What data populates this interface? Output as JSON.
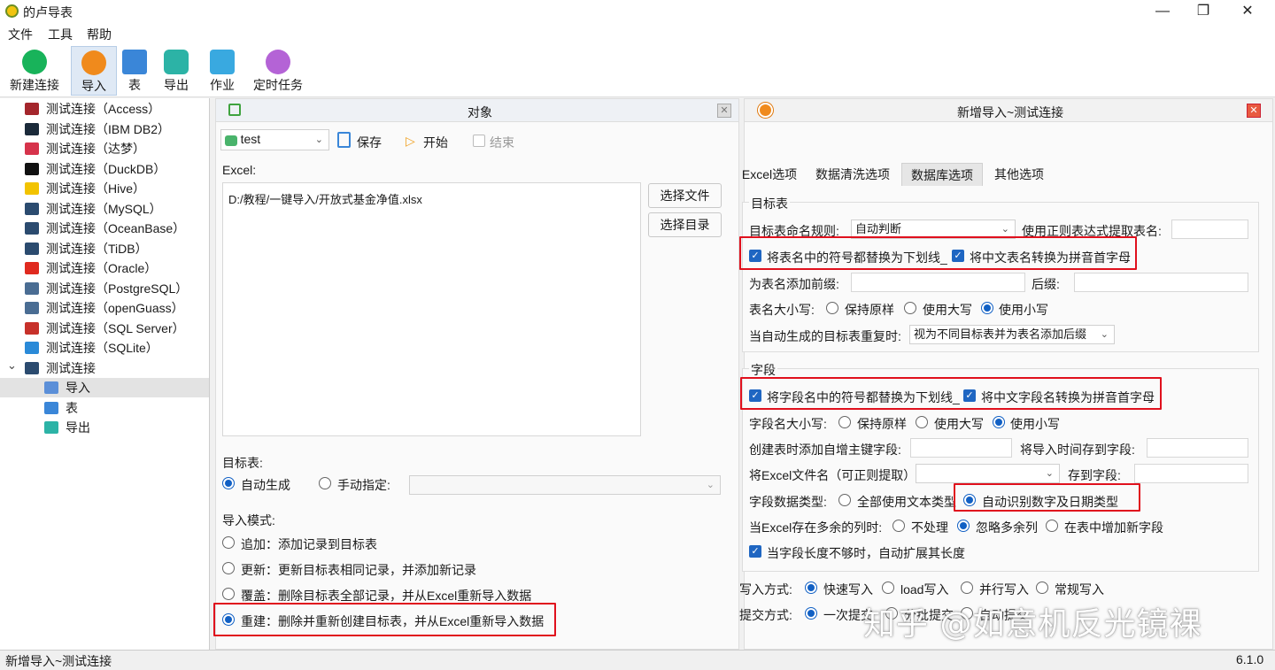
{
  "window": {
    "title": "的卢导表",
    "min_glyph": "—",
    "max_glyph": "❐",
    "close_glyph": "✕"
  },
  "menu": [
    "文件",
    "工具",
    "帮助"
  ],
  "toolbar": [
    {
      "label": "新建连接",
      "icon": "link-icon",
      "color": "#18b35a"
    },
    {
      "label": "导入",
      "icon": "import-icon",
      "color": "#f08a1c"
    },
    {
      "label": "表",
      "icon": "table-icon",
      "color": "#3a86d8"
    },
    {
      "label": "导出",
      "icon": "export-icon",
      "color": "#2cb3a6"
    },
    {
      "label": "作业",
      "icon": "job-icon",
      "color": "#39a9e0"
    },
    {
      "label": "定时任务",
      "icon": "schedule-icon",
      "color": "#b463d6"
    }
  ],
  "tree": {
    "connections": [
      {
        "label": "测试连接（Access）",
        "color": "#a4262c"
      },
      {
        "label": "测试连接（IBM DB2）",
        "color": "#1b2a3a"
      },
      {
        "label": "测试连接（达梦）",
        "color": "#d6334b"
      },
      {
        "label": "测试连接（DuckDB）",
        "color": "#111111"
      },
      {
        "label": "测试连接（Hive）",
        "color": "#f2c300"
      },
      {
        "label": "测试连接（MySQL）",
        "color": "#2b4b6f"
      },
      {
        "label": "测试连接（OceanBase）",
        "color": "#2b4b6f"
      },
      {
        "label": "测试连接（TiDB）",
        "color": "#2b4b6f"
      },
      {
        "label": "测试连接（Oracle）",
        "color": "#e02a1f"
      },
      {
        "label": "测试连接（PostgreSQL）",
        "color": "#4a6d93"
      },
      {
        "label": "测试连接（openGuass）",
        "color": "#4a6d93"
      },
      {
        "label": "测试连接（SQL Server）",
        "color": "#c7312a"
      },
      {
        "label": "测试连接（SQLite）",
        "color": "#2a8ad8"
      },
      {
        "label": "测试连接",
        "color": "#2b4b6f"
      }
    ],
    "children": [
      {
        "label": "导入",
        "color": "#5b8fd8"
      },
      {
        "label": "表",
        "color": "#3a86d8"
      },
      {
        "label": "导出",
        "color": "#2cb3a6"
      }
    ],
    "expander": "⌄"
  },
  "object_panel": {
    "title": "对象",
    "db_select": "test",
    "save": "保存",
    "start": "开始",
    "end": "结束",
    "excel_label": "Excel:",
    "excel_path": "D:/教程/一键导入/开放式基金净值.xlsx",
    "choose_file": "选择文件",
    "choose_dir": "选择目录",
    "target_label": "目标表:",
    "auto_gen": "自动生成",
    "manual": "手动指定:",
    "mode_label": "导入模式:",
    "modes": [
      "追加：添加记录到目标表",
      "更新：更新目标表相同记录，并添加新记录",
      "覆盖：删除目标表全部记录，并从Excel重新导入数据",
      "重建：删除并重新创建目标表，并从Excel重新导入数据"
    ]
  },
  "import_panel": {
    "title": "新增导入~测试连接",
    "tabs": [
      "Excel选项",
      "数据清洗选项",
      "数据库选项",
      "其他选项"
    ],
    "target_group": "目标表",
    "naming_rule_label": "目标表命名规则:",
    "naming_rule_value": "自动判断",
    "regex_label": "使用正则表达式提取表名:",
    "cb_table_symbols": "将表名中的符号都替换为下划线_",
    "cb_table_pinyin": "将中文表名转换为拼音首字母",
    "prefix_label": "为表名添加前缀:",
    "suffix_label": "后缀:",
    "case_label": "表名大小写:",
    "keep": "保持原样",
    "upper": "使用大写",
    "lower": "使用小写",
    "dup_label": "当自动生成的目标表重复时:",
    "dup_value": "视为不同目标表并为表名添加后缀",
    "field_group": "字段",
    "cb_field_symbols": "将字段名中的符号都替换为下划线_",
    "cb_field_pinyin": "将中文字段名转换为拼音首字母",
    "field_case_label": "字段名大小写:",
    "pk_label": "创建表时添加自增主键字段:",
    "time_label": "将导入时间存到字段:",
    "filename_label": "将Excel文件名（可正则提取）",
    "store_label": "存到字段:",
    "type_label": "字段数据类型:",
    "all_text": "全部使用文本类型",
    "auto_detect": "自动识别数字及日期类型",
    "extra_cols_label": "当Excel存在多余的列时:",
    "no_handle": "不处理",
    "ignore": "忽略多余列",
    "add_field": "在表中增加新字段",
    "cb_expand": "当字段长度不够时，自动扩展其长度",
    "write_label": "写入方式:",
    "write_opts": [
      "快速写入",
      "load写入",
      "并行写入",
      "常规写入"
    ],
    "commit_label": "提交方式:",
    "commit_opts": [
      "一次提交",
      "分批提交",
      "自动提交"
    ]
  },
  "status": {
    "left": "新增导入~测试连接",
    "right": "6.1.0"
  },
  "watermark": "知乎 @如意机反光镜裸"
}
